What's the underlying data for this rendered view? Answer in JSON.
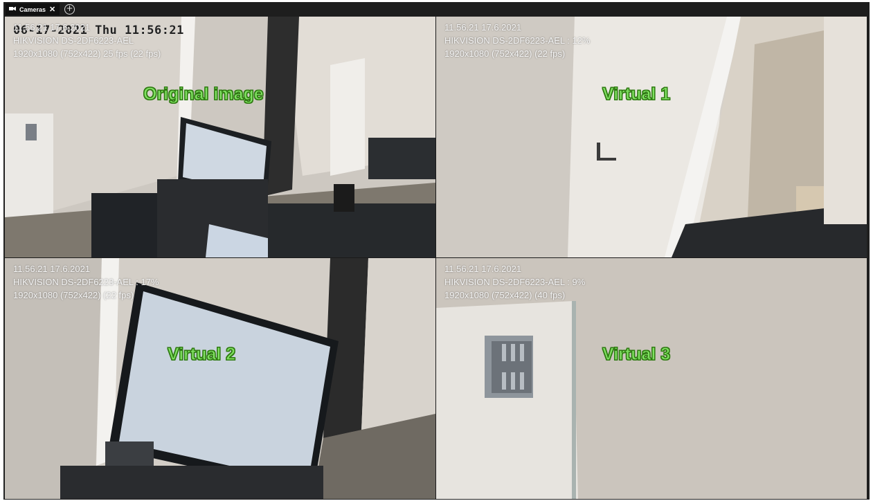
{
  "tabs": [
    {
      "label": "Cameras",
      "icon": "camera-icon",
      "close": "✕"
    }
  ],
  "add_tab_icon": "plus-circle-icon",
  "panes": [
    {
      "name": "original",
      "line1": "11.56.21  17.6.2021",
      "line2": "HIKVISION DS-2DF6223-AEL",
      "line3": "1920x1080 (752x422) 25 fps (22 fps)",
      "osd": "06-17-2021 Thu 11:56:21",
      "label": "Original image"
    },
    {
      "name": "virtual-1",
      "line1": "11.56.21  17.6.2021",
      "line2": "HIKVISION DS-2DF6223-AEL : 12%",
      "line3": "1920x1080 (752x422)  (22 fps)",
      "label": "Virtual 1"
    },
    {
      "name": "virtual-2",
      "line1": "11.56.21  17.6.2021",
      "line2": "HIKVISION DS-2DF6223-AEL : 17%",
      "line3": "1920x1080 (752x422)  (22 fps)",
      "label": "Virtual 2"
    },
    {
      "name": "virtual-3",
      "line1": "11.56.21  17.6.2021",
      "line2": "HIKVISION DS-2DF6223-AEL : 9%",
      "line3": "1920x1080 (752x422)  (40 fps)",
      "label": "Virtual 3"
    }
  ],
  "colors": {
    "label_fill": "#7fe061",
    "label_outline": "#2f7a12",
    "overlay_text": "#f4f4f4",
    "frame_bg": "#1f1f1f"
  }
}
